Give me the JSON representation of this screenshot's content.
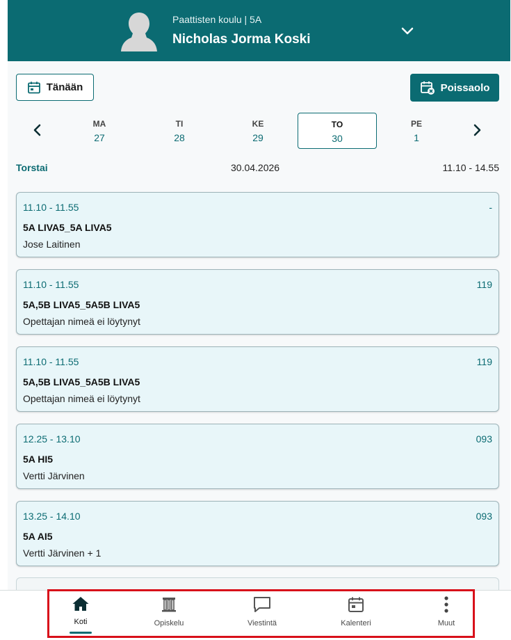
{
  "header": {
    "school": "Paattisten koulu | 5A",
    "student": "Nicholas Jorma Koski",
    "avatar_icon": "person-silhouette-icon",
    "menu_icon": "chevron-down-icon"
  },
  "toolbar": {
    "today_label": "Tänään",
    "absence_label": "Poissaolo"
  },
  "week": {
    "days": [
      {
        "name": "MA",
        "num": "27"
      },
      {
        "name": "TI",
        "num": "28"
      },
      {
        "name": "KE",
        "num": "29"
      },
      {
        "name": "TO",
        "num": "30"
      },
      {
        "name": "PE",
        "num": "1"
      }
    ],
    "selected": "TO"
  },
  "day_info": {
    "weekday": "Torstai",
    "date": "30.04.2026",
    "span": "11.10 - 14.55"
  },
  "lessons": [
    {
      "time": "11.10 - 11.55",
      "room": "-",
      "course": "5A LIVA5_5A LIVA5",
      "teacher": "Jose Laitinen"
    },
    {
      "time": "11.10 - 11.55",
      "room": "119",
      "course": "5A,5B LIVA5_5A5B LIVA5",
      "teacher": "Opettajan nimeä ei löytynyt"
    },
    {
      "time": "11.10 - 11.55",
      "room": "119",
      "course": "5A,5B LIVA5_5A5B LIVA5",
      "teacher": "Opettajan nimeä ei löytynyt"
    },
    {
      "time": "12.25 - 13.10",
      "room": "093",
      "course": "5A HI5",
      "teacher": "Vertti Järvinen"
    },
    {
      "time": "13.25 - 14.10",
      "room": "093",
      "course": "5A AI5",
      "teacher": "Vertti Järvinen + 1"
    }
  ],
  "bottom_nav": {
    "items": [
      {
        "label": "Koti",
        "icon": "home-icon"
      },
      {
        "label": "Opiskelu",
        "icon": "study-icon"
      },
      {
        "label": "Viestintä",
        "icon": "message-icon"
      },
      {
        "label": "Kalenteri",
        "icon": "calendar-icon"
      },
      {
        "label": "Muut",
        "icon": "more-icon"
      }
    ],
    "active": "Koti"
  },
  "colors": {
    "brand": "#0b6b72",
    "card_bg": "#e8f6f9",
    "highlight": "#d8101a"
  }
}
